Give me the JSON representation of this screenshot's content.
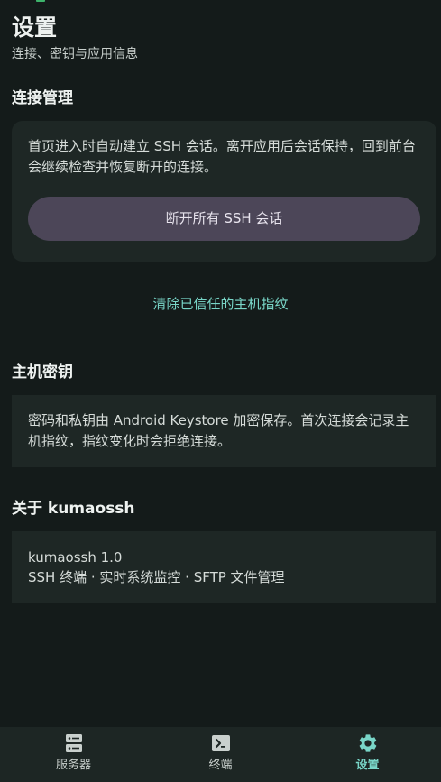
{
  "header": {
    "title": "设置",
    "subtitle": "连接、密钥与应用信息"
  },
  "connection": {
    "section_title": "连接管理",
    "description": "首页进入时自动建立 SSH 会话。离开应用后会话保持，回到前台会继续检查并恢复断开的连接。",
    "disconnect_label": "断开所有 SSH 会话",
    "clear_hosts_label": "清除已信任的主机指纹"
  },
  "host_keys": {
    "section_title": "主机密钥",
    "description": "密码和私钥由 Android Keystore 加密保存。首次连接会记录主机指纹，指纹变化时会拒绝连接。"
  },
  "about": {
    "section_title": "关于 kumaossh",
    "version": "kumaossh 1.0",
    "features": "SSH 终端 · 实时系统监控 · SFTP 文件管理"
  },
  "bottom_nav": {
    "items": [
      {
        "label": "服务器",
        "icon": "server-icon",
        "active": false
      },
      {
        "label": "终端",
        "icon": "terminal-icon",
        "active": false
      },
      {
        "label": "设置",
        "icon": "gear-icon",
        "active": true
      }
    ]
  },
  "colors": {
    "background": "#141b1a",
    "card": "#1e2725",
    "accent": "#79d6c8",
    "button": "#4c4658"
  }
}
